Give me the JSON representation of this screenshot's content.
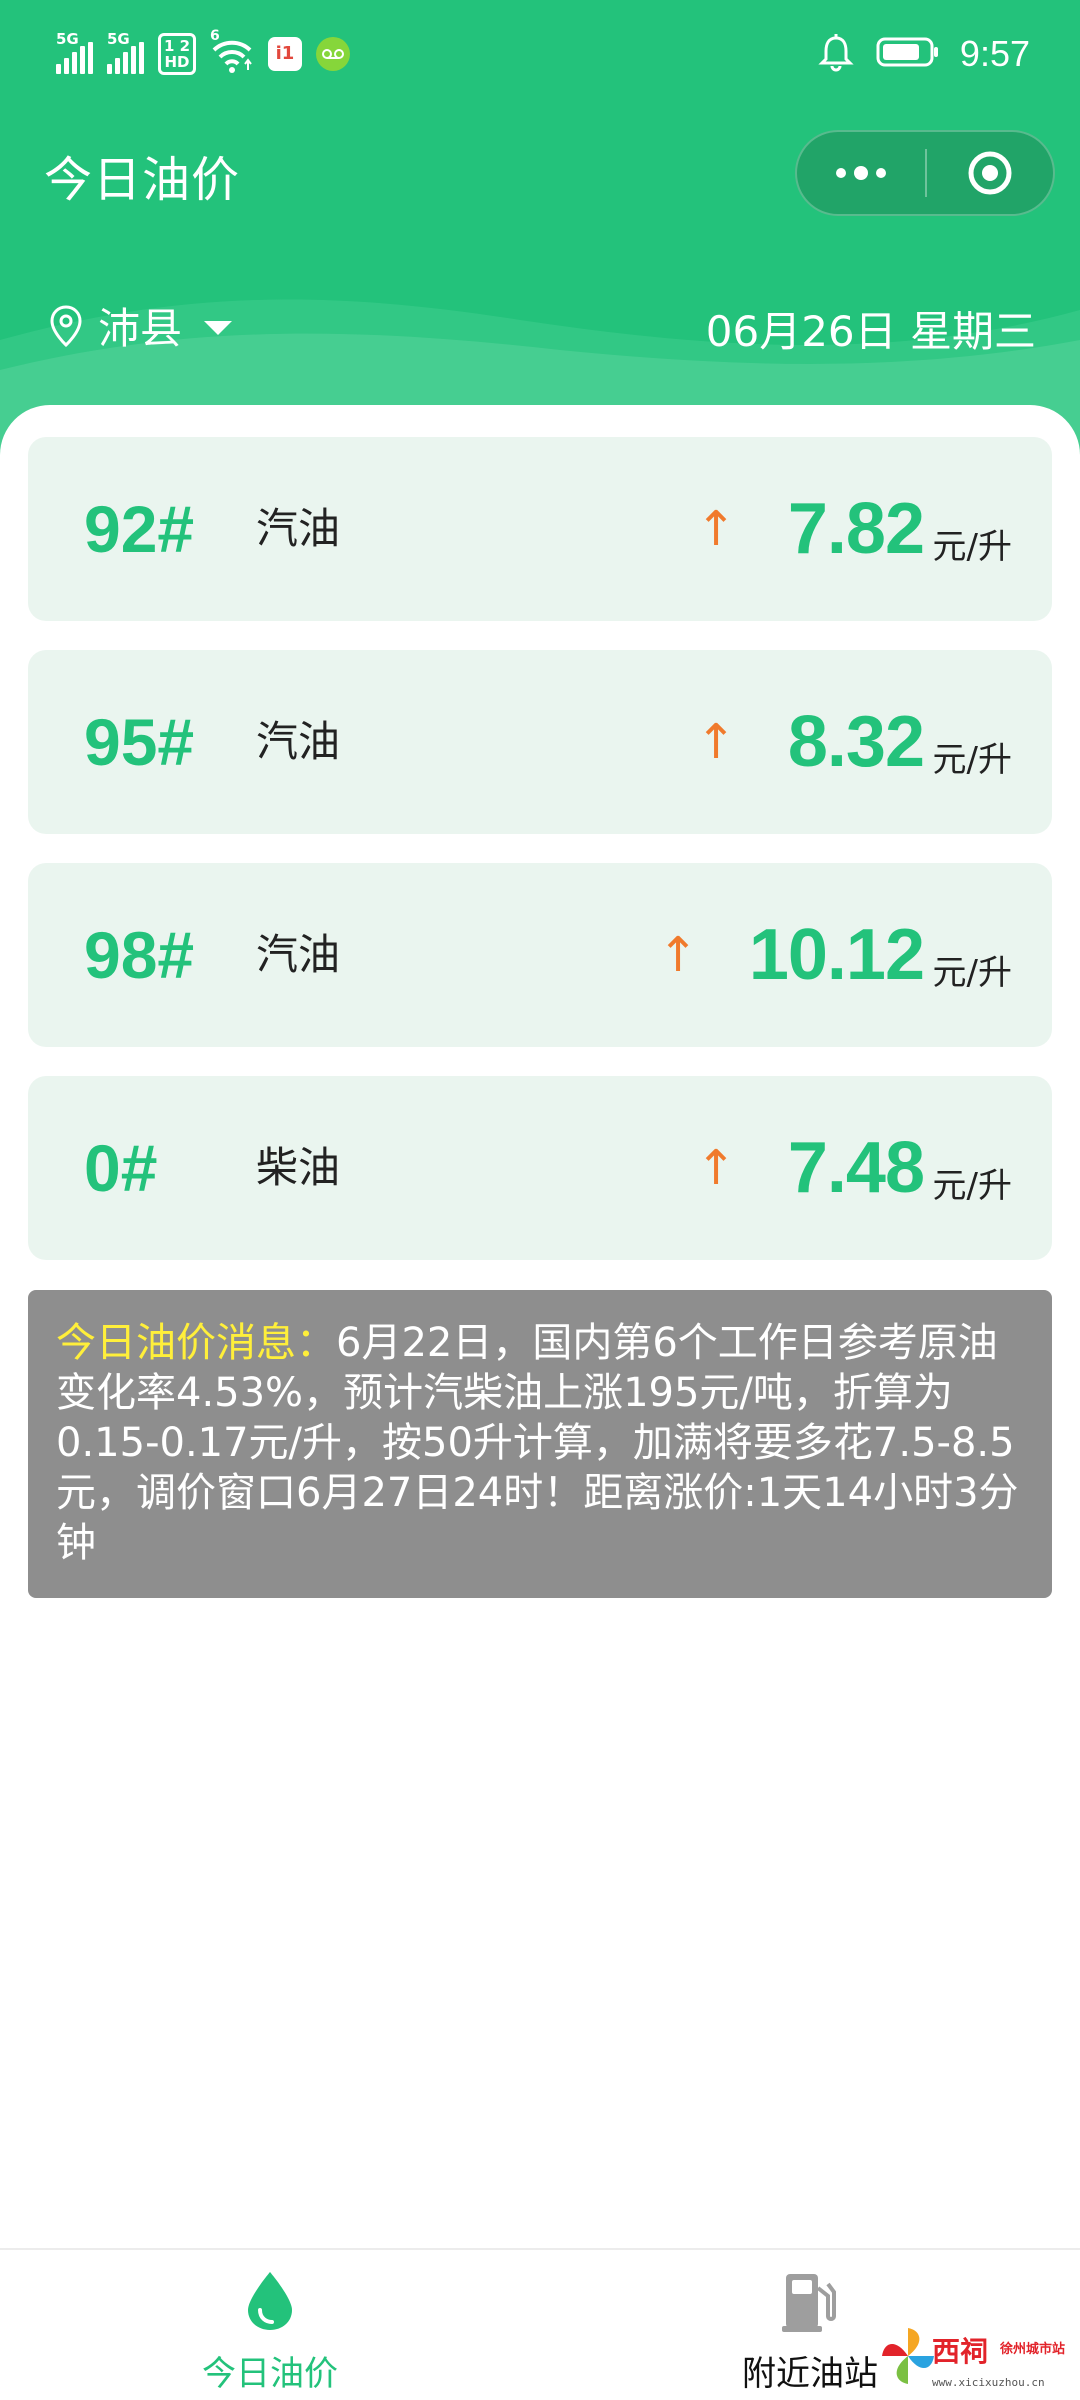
{
  "status_bar": {
    "signal1_label": "5G",
    "signal2_label": "5G",
    "hd_label_top": "1 2",
    "hd_label_bottom": "HD",
    "wifi_label": "6",
    "app_badge": "i1",
    "time": "9:57"
  },
  "nav": {
    "title": "今日油价"
  },
  "location": {
    "city": "沛县",
    "date": "06月26日 星期三"
  },
  "prices": [
    {
      "grade": "92#",
      "fuel": "汽油",
      "arrow": "↑",
      "price": "7.82",
      "unit": "元/升"
    },
    {
      "grade": "95#",
      "fuel": "汽油",
      "arrow": "↑",
      "price": "8.32",
      "unit": "元/升"
    },
    {
      "grade": "98#",
      "fuel": "汽油",
      "arrow": "↑",
      "price": "10.12",
      "unit": "元/升"
    },
    {
      "grade": "0#",
      "fuel": "柴油",
      "arrow": "↑",
      "price": "7.48",
      "unit": "元/升"
    }
  ],
  "news": {
    "label": "今日油价消息：",
    "text": "6月22日，国内第6个工作日参考原油变化率4.53%，预计汽柴油上涨195元/吨，折算为0.15-0.17元/升，按50升计算，加满将要多花7.5-8.5元，调价窗口6月27日24时！距离涨价:1天14小时3分钟"
  },
  "tabbar": {
    "tab1_label": "今日油价",
    "tab2_label": "附近油站"
  },
  "watermark": {
    "title": "西祠",
    "sub": "徐州城市站",
    "url": "www.xicixuzhou.cn"
  },
  "colors": {
    "brand_green": "#23c27b",
    "arrow_orange": "#f07a2c",
    "news_bg": "#8e8e8e",
    "news_highlight": "#ffef3a",
    "card_bg": "#eaf5ef"
  }
}
